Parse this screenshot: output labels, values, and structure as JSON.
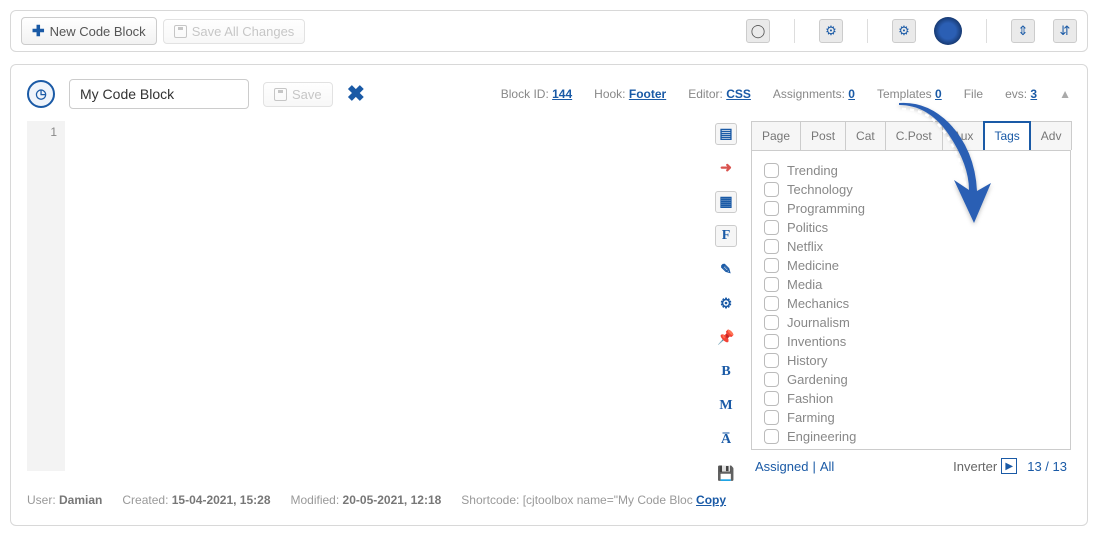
{
  "topbar": {
    "new_block": "New Code Block",
    "save_all": "Save All Changes"
  },
  "header": {
    "name_value": "My Code Block",
    "save_label": "Save",
    "block_id_lbl": "Block ID:",
    "block_id": "144",
    "hook_lbl": "Hook:",
    "hook": "Footer",
    "editor_lbl": "Editor:",
    "editor": "CSS",
    "assign_lbl": "Assignments:",
    "assign": "0",
    "templates_lbl": "Templates",
    "templates": "0",
    "file_lbl": "File",
    "revs_lbl": "evs:",
    "revs": "3"
  },
  "code": {
    "line1": "1"
  },
  "tabs": {
    "page": "Page",
    "post": "Post",
    "cat": "Cat",
    "cpost": "C.Post",
    "aux": "Aux",
    "tags": "Tags",
    "adv": "Adv"
  },
  "tags": [
    "Trending",
    "Technology",
    "Programming",
    "Politics",
    "Netflix",
    "Medicine",
    "Media",
    "Mechanics",
    "Journalism",
    "Inventions",
    "History",
    "Gardening",
    "Fashion",
    "Farming",
    "Engineering"
  ],
  "rf": {
    "assigned": "Assigned",
    "all": "All",
    "inverter": "Inverter",
    "count_a": "13",
    "count_b": "13"
  },
  "footer": {
    "user_lbl": "User:",
    "user": "Damian",
    "created_lbl": "Created:",
    "created": "15-04-2021, 15:28",
    "modified_lbl": "Modified:",
    "modified": "20-05-2021, 12:18",
    "shortcode_lbl": "Shortcode:",
    "shortcode": "[cjtoolbox name=\"My Code Bloc",
    "copy": "Copy"
  }
}
